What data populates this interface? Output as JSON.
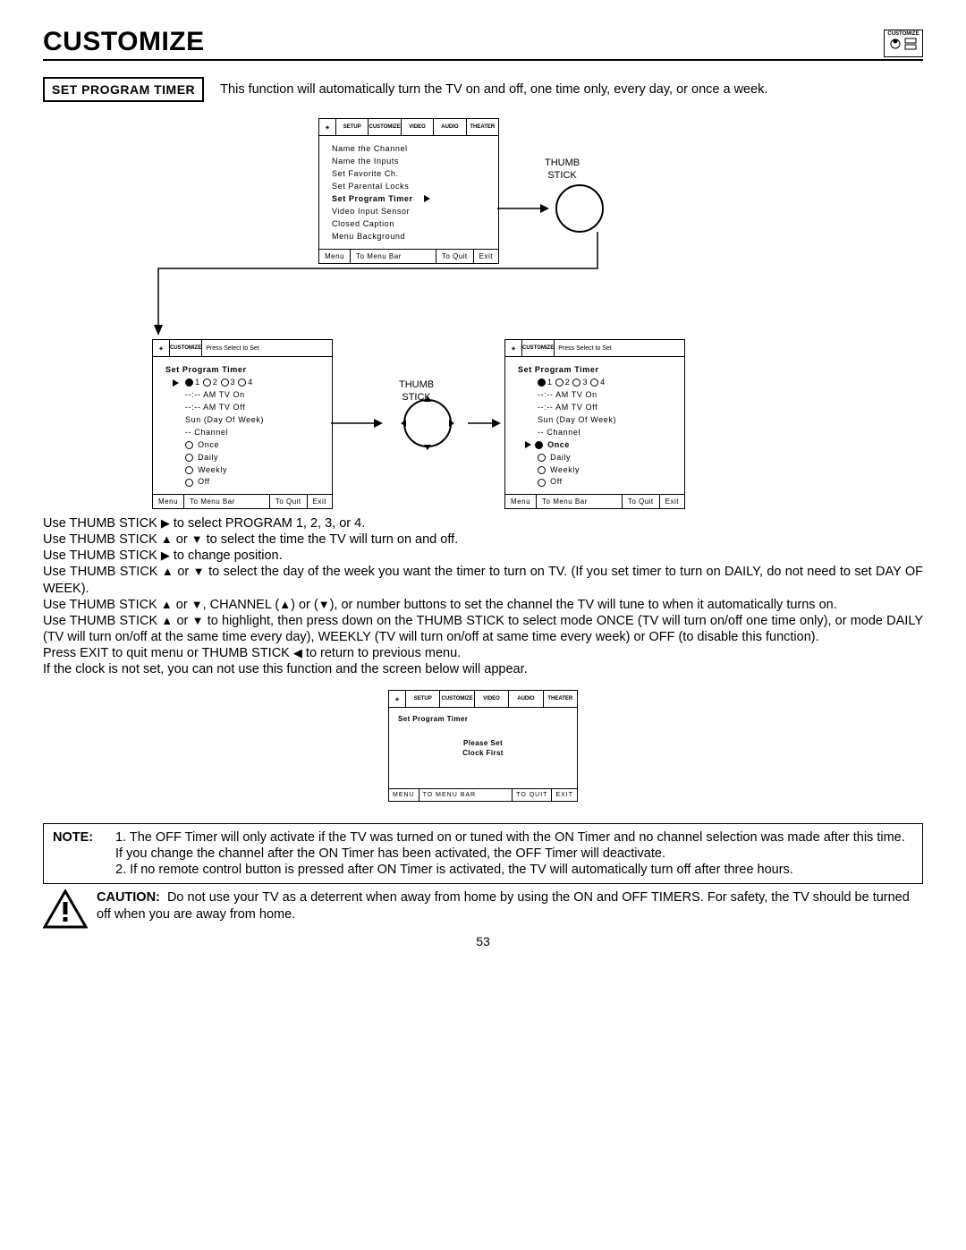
{
  "page": {
    "title": "CUSTOMIZE",
    "number": "53",
    "corner_icon_label": "CUSTOMIZE"
  },
  "intro": {
    "box_label": "SET PROGRAM TIMER",
    "description": "This function will automatically turn the TV on and off, one time only, every day, or once a week."
  },
  "tabs": [
    "SETUP",
    "CUSTOMIZE",
    "VIDEO",
    "AUDIO",
    "THEATER"
  ],
  "screen1": {
    "items": [
      "Name the Channel",
      "Name the Inputs",
      "Set Favorite Ch.",
      "Set Parental Locks",
      "Set Program Timer",
      "Video Input Sensor",
      "Closed Caption",
      "Menu Background"
    ],
    "selected_index": 4,
    "foot": {
      "menu": "Menu",
      "mid": "To Menu Bar",
      "quit": "To Quit",
      "exit": "Exit"
    }
  },
  "screen2": {
    "press": "Press Select to Set",
    "title": "Set Program Timer",
    "programs": [
      "1",
      "2",
      "3",
      "4"
    ],
    "selected_program": 0,
    "lines": [
      "--:-- AM TV On",
      "--:-- AM TV Off",
      "Sun (Day Of Week)",
      "-- Channel"
    ],
    "modes": [
      "Once",
      "Daily",
      "Weekly",
      "Off"
    ],
    "selected_mode": -1,
    "foot": {
      "menu": "Menu",
      "mid": "To Menu Bar",
      "quit": "To Quit",
      "exit": "Exit"
    }
  },
  "screen3": {
    "press": "Press Select to Set",
    "title": "Set Program Timer",
    "programs": [
      "1",
      "2",
      "3",
      "4"
    ],
    "selected_program": 0,
    "lines": [
      "--:-- AM TV On",
      "--:-- AM TV Off",
      "Sun (Day Of Week)",
      "-- Channel"
    ],
    "modes": [
      "Once",
      "Daily",
      "Weekly",
      "Off"
    ],
    "selected_mode": 0,
    "foot": {
      "menu": "Menu",
      "mid": "To Menu Bar",
      "quit": "To Quit",
      "exit": "Exit"
    }
  },
  "thumb_label": "THUMB\nSTICK",
  "instructions": {
    "l1a": "Use THUMB STICK ",
    "l1b": " to select PROGRAM 1, 2, 3, or 4.",
    "l2a": "Use THUMB STICK ",
    "l2b": " or ",
    "l2c": " to select the time the TV will turn on and off.",
    "l3a": "Use THUMB STICK ",
    "l3b": " to change position.",
    "l4a": "Use THUMB STICK ",
    "l4b": " or ",
    "l4c": " to select the day of the week you want the timer to turn on TV. (If you set timer to turn on DAILY, do not need to set DAY OF WEEK).",
    "l5a": "Use THUMB STICK ",
    "l5b": " or ",
    "l5c": ", CHANNEL (",
    "l5d": ") or (",
    "l5e": "), or number buttons to set the channel the TV will tune to when it automatically turns on.",
    "l6a": "Use THUMB STICK ",
    "l6b": " or ",
    "l6c": " to highlight, then press down on the THUMB STICK to select mode ONCE (TV will turn on/off one time only), or mode DAILY (TV will turn on/off at the same time every day), WEEKLY (TV will turn on/off at same time every week) or OFF (to disable this function).",
    "l7a": "Press EXIT to quit menu or THUMB STICK ",
    "l7b": " to return to previous menu.",
    "l8": "If the clock is not set, you can not use this function and the screen below will appear."
  },
  "clock_screen": {
    "title": "Set Program Timer",
    "msg": "Please Set\nClock First",
    "foot": {
      "menu": "MENU",
      "mid": "TO MENU BAR",
      "quit": "TO QUIT",
      "exit": "EXIT"
    }
  },
  "note": {
    "label": "NOTE:",
    "text": "1. The OFF Timer will only activate if the TV was turned on or tuned with the ON Timer and no channel selection was made after this time.  If you change the channel after the ON Timer has been activated, the OFF Timer will deactivate.\n2. If no remote control button is pressed after ON Timer is activated, the TV will automatically turn off after three hours."
  },
  "caution": {
    "label": "CAUTION:",
    "text": "Do not use your TV as a deterrent when away from home by using the ON and OFF TIMERS.  For safety, the TV should be turned off when you are away from home."
  }
}
